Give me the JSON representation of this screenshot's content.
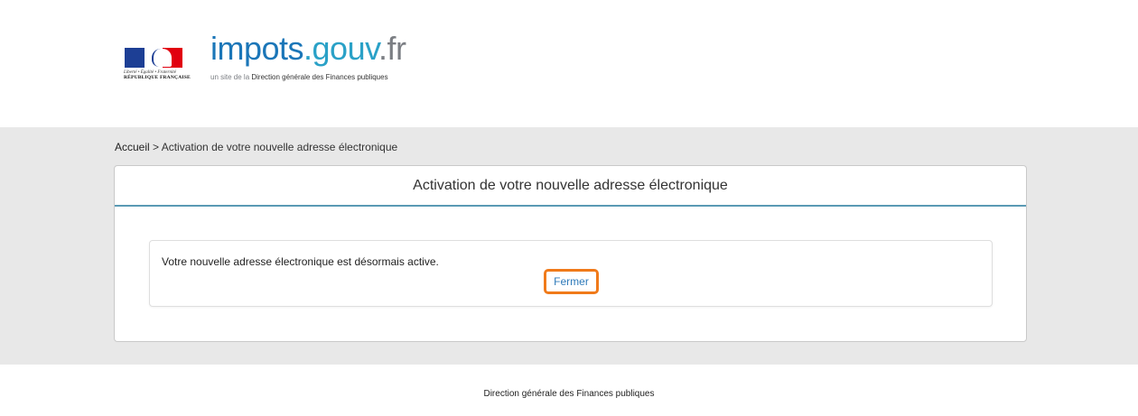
{
  "header": {
    "rf_logo": {
      "motto": "Liberté • Égalité • Fraternité",
      "name": "RÉPUBLIQUE FRANÇAISE"
    },
    "brand": {
      "part1": "impots",
      "part2": ".gouv",
      "part3": ".fr",
      "subtitle_prefix": "un site de la ",
      "subtitle_main": "Direction générale des Finances publiques"
    }
  },
  "breadcrumb": {
    "home": "Accueil",
    "separator": " > ",
    "current": "Activation de votre nouvelle adresse électronique"
  },
  "panel": {
    "title": "Activation de votre nouvelle adresse électronique",
    "message": "Votre nouvelle adresse électronique est désormais active.",
    "close_label": "Fermer"
  },
  "footer": {
    "text": "Direction générale des Finances publiques"
  },
  "colors": {
    "brand_blue": "#1b76b8",
    "brand_teal": "#2aa1c7",
    "accent_orange": "#f07a1a",
    "band_gray": "#e8e8e8"
  }
}
